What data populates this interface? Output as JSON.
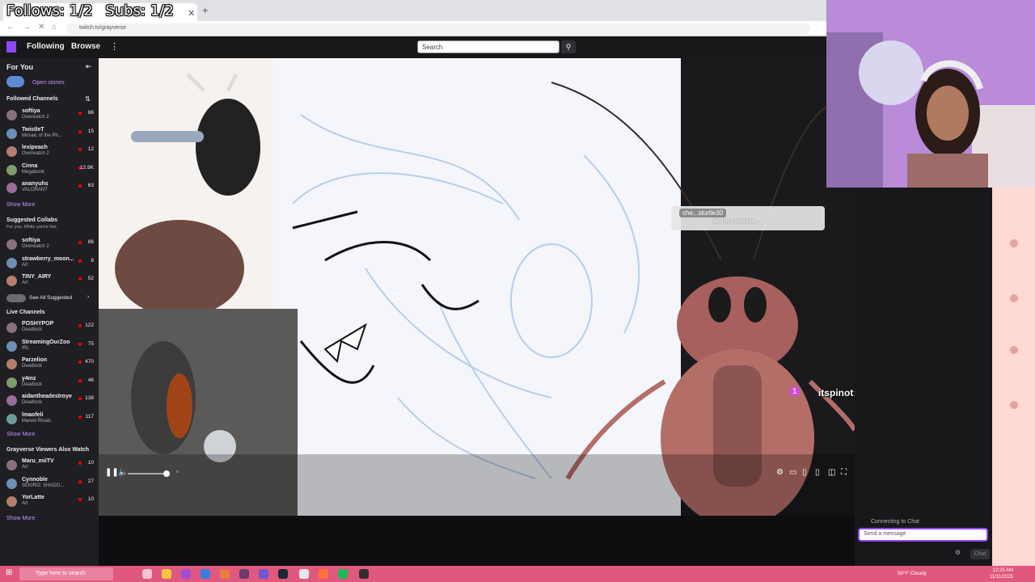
{
  "overlay": {
    "follows": "Follows: 1/2",
    "subs": "Subs: 1/2"
  },
  "browser": {
    "url": "twitch.tv/grayverse"
  },
  "nav": {
    "following": "Following",
    "browse": "Browse",
    "search_placeholder": "Search"
  },
  "sidebar": {
    "for_you": "For You",
    "open_stories": "Open stories",
    "followed_header": "Followed Channels",
    "followed": [
      {
        "name": "softiya",
        "game": "Overwatch 2",
        "viewers": "86"
      },
      {
        "name": "TwistleT",
        "game": "Mosaic of the Ph...",
        "viewers": "15"
      },
      {
        "name": "lexipeach",
        "game": "Overwatch 2",
        "viewers": "12"
      },
      {
        "name": "Cinna",
        "game": "Megabonk",
        "viewers": "12.9K"
      },
      {
        "name": "ananyuhs",
        "game": "VALORANT",
        "viewers": "63"
      }
    ],
    "show_more_1": "Show More",
    "suggested_header": "Suggested Collabs",
    "suggested_sub": "For you. While you're live.",
    "suggested": [
      {
        "name": "softiya",
        "game": "Overwatch 2",
        "viewers": "86"
      },
      {
        "name": "strawberry_moon...",
        "game": "Art",
        "viewers": "8"
      },
      {
        "name": "TINY_AIRY",
        "game": "Art",
        "viewers": "52"
      }
    ],
    "see_all": "See All Suggested",
    "live_header": "Live Channels",
    "live": [
      {
        "name": "POSHYPOP",
        "game": "Deadlock",
        "viewers": "122"
      },
      {
        "name": "StreamingOurZoo",
        "game": "IRL",
        "viewers": "75"
      },
      {
        "name": "Parzelion",
        "game": "Deadlock",
        "viewers": "470"
      },
      {
        "name": "y4mz",
        "game": "Deadlock",
        "viewers": "46"
      },
      {
        "name": "aidantheadestroye",
        "game": "Deadlock",
        "viewers": "138"
      },
      {
        "name": "lmaofeli",
        "game": "Marvel Rivals",
        "viewers": "117"
      }
    ],
    "show_more_2": "Show More",
    "also_header": "Grayverse Viewers Also Watch",
    "also": [
      {
        "name": "Maru_miiTV",
        "game": "Art",
        "viewers": "10"
      },
      {
        "name": "Cynnoble",
        "game": "SEKIRO: SHADO...",
        "viewers": "27"
      },
      {
        "name": "YorLatte",
        "game": "Art",
        "viewers": "10"
      }
    ],
    "show_more_3": "Show More"
  },
  "stream": {
    "alert_name": "che...sturtle30",
    "alert_msg": "lkr, i'm a rare bre...",
    "sub_name": "itspinot:",
    "sub_badge": "1"
  },
  "chat": {
    "status": "Connecting to Chat",
    "placeholder": "Send a message",
    "button": "Chat"
  },
  "taskbar": {
    "search_placeholder": "Type here to search",
    "weather": "50°F Cloudy",
    "time": "12:25 AM",
    "date": "11/11/2025"
  },
  "colors": {
    "twitch_purple": "#9147ff",
    "taskbar_pink": "#e1587e",
    "live_red": "#eb0400"
  }
}
